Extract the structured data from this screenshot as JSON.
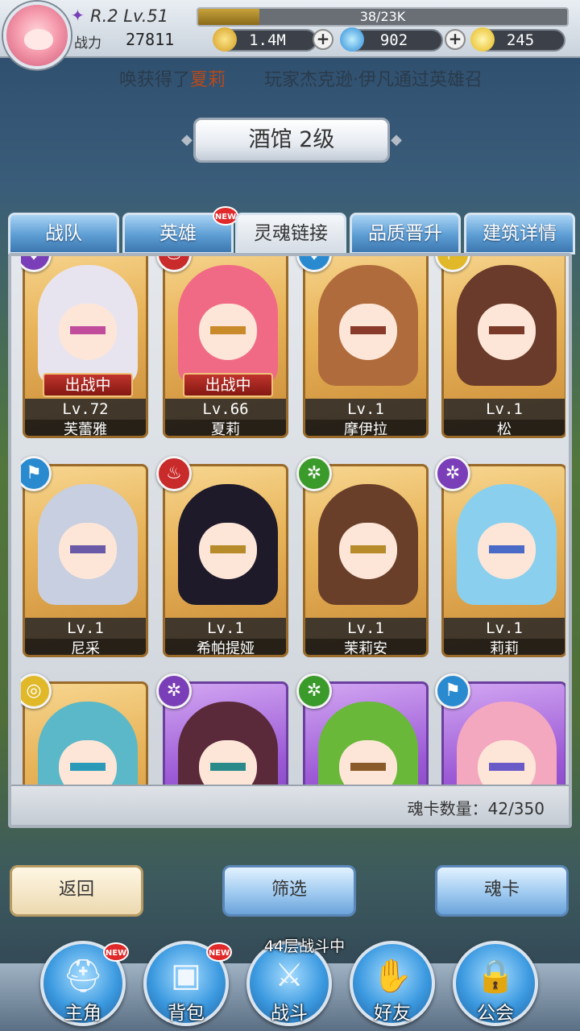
{
  "player": {
    "rank_level": "R.2 Lv.51",
    "exp_text": "38/23K",
    "exp_fraction": 0.165,
    "power_label": "战力",
    "power_value": "27811"
  },
  "currencies": [
    {
      "name": "gold-coin-icon",
      "value": "1.4M",
      "color": "#e1b73a"
    },
    {
      "name": "blue-gem-icon",
      "value": "902",
      "color": "#3fb8e8"
    },
    {
      "name": "yellow-crystal-icon",
      "value": "245",
      "color": "#f3d23a"
    }
  ],
  "marquee": {
    "part1": "唤获得了",
    "hero": "夏莉",
    "part2": "玩家杰克逊·伊凡通过英雄召"
  },
  "title": "酒馆 2级",
  "tabs": [
    {
      "label": "战队",
      "active": false
    },
    {
      "label": "英雄",
      "active": true,
      "badge": "NEW"
    },
    {
      "label": "灵魂链接",
      "active": true
    },
    {
      "label": "品质晋升",
      "active": false
    },
    {
      "label": "建筑详情",
      "active": false
    }
  ],
  "heroes": [
    {
      "name": "芙蕾雅",
      "level": "Lv.72",
      "status": "出战中",
      "element": "wing-icon",
      "elem_color": "#7a3fb8",
      "hair": "#e8e4ef",
      "eye": "#c24c9c",
      "frame": "gold"
    },
    {
      "name": "夏莉",
      "level": "Lv.66",
      "status": "出战中",
      "element": "flame-icon",
      "elem_color": "#c92a2a",
      "hair": "#f06a86",
      "eye": "#c98a2a",
      "frame": "gold"
    },
    {
      "name": "摩伊拉",
      "level": "Lv.1",
      "status": "",
      "element": "wing-icon",
      "elem_color": "#2a8ad0",
      "hair": "#b06b3c",
      "eye": "#8a3a2a",
      "frame": "gold"
    },
    {
      "name": "松",
      "level": "Lv.1",
      "status": "",
      "element": "banner-icon",
      "elem_color": "#e0b828",
      "hair": "#6a3a2a",
      "eye": "#7a3a2a",
      "frame": "gold"
    },
    {
      "name": "尼采",
      "level": "Lv.1",
      "status": "",
      "element": "banner-icon",
      "elem_color": "#2a8ad0",
      "hair": "#c7cfe0",
      "eye": "#6a5aa8",
      "frame": "gold"
    },
    {
      "name": "希帕提娅",
      "level": "Lv.1",
      "status": "",
      "element": "flame-icon",
      "elem_color": "#c92a2a",
      "hair": "#1e1a2a",
      "eye": "#b78a2a",
      "frame": "gold"
    },
    {
      "name": "茉莉安",
      "level": "Lv.1",
      "status": "",
      "element": "shuriken-icon",
      "elem_color": "#3a9a2a",
      "hair": "#6a3f2a",
      "eye": "#b78a2a",
      "frame": "gold"
    },
    {
      "name": "莉莉",
      "level": "Lv.1",
      "status": "",
      "element": "shuriken-icon",
      "elem_color": "#7a3fb8",
      "hair": "#8ad0ee",
      "eye": "#4a6ac8",
      "frame": "gold"
    },
    {
      "name": "",
      "level": "",
      "status": "",
      "element": "target-icon",
      "elem_color": "#e0b828",
      "hair": "#5ab8c8",
      "eye": "#2a9ab8",
      "frame": "gold"
    },
    {
      "name": "",
      "level": "",
      "status": "",
      "element": "shuriken-icon",
      "elem_color": "#7a3fb8",
      "hair": "#5a2a3a",
      "eye": "#2a8a8a",
      "frame": "purple"
    },
    {
      "name": "",
      "level": "",
      "status": "",
      "element": "shuriken-icon",
      "elem_color": "#3a9a2a",
      "hair": "#6ab83a",
      "eye": "#8a5a2a",
      "frame": "purple"
    },
    {
      "name": "",
      "level": "",
      "status": "",
      "element": "banner-icon",
      "elem_color": "#2a8ad0",
      "hair": "#f4a8c0",
      "eye": "#6a5ac8",
      "frame": "purple"
    }
  ],
  "card_count": "魂卡数量：42/350",
  "buttons": {
    "back": "返回",
    "filter": "筛选",
    "soul_card": "魂卡"
  },
  "battle_status": "44层战斗中",
  "nav": [
    {
      "label": "主角",
      "icon": "helmet-icon",
      "badge": "NEW"
    },
    {
      "label": "背包",
      "icon": "backpack-icon",
      "badge": "NEW"
    },
    {
      "label": "战斗",
      "icon": "crossed-swords-icon",
      "badge": ""
    },
    {
      "label": "好友",
      "icon": "handshake-icon",
      "badge": ""
    },
    {
      "label": "公会",
      "icon": "lock-icon",
      "badge": ""
    }
  ]
}
